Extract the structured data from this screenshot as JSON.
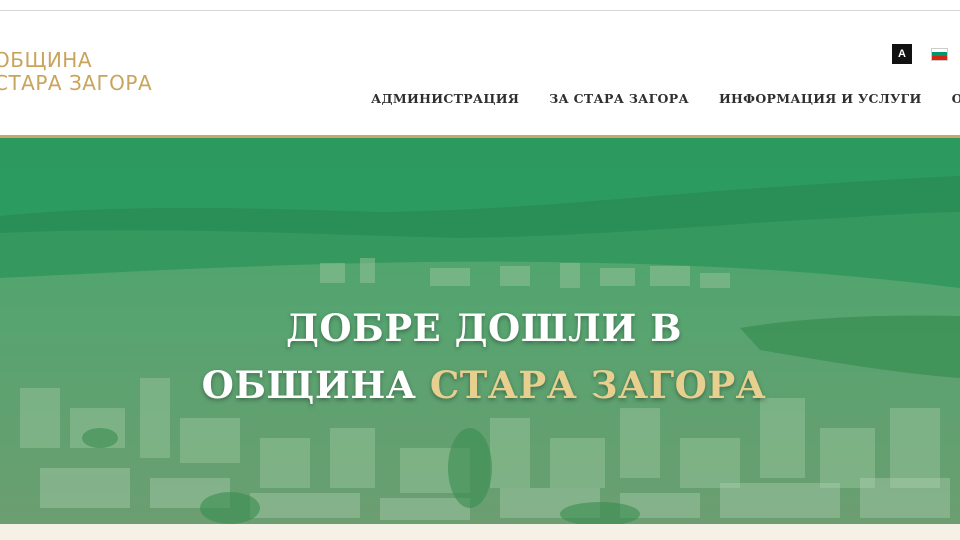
{
  "logo": {
    "line1": "ОБЩИНА",
    "line2": "СТАРА ЗАГОРА"
  },
  "utility": {
    "contrast_label": "A",
    "language_flag": "bulgarian-flag-icon"
  },
  "nav": {
    "items": [
      {
        "label": "АДМИНИСТРАЦИЯ"
      },
      {
        "label": "ЗА СТАРА ЗАГОРА"
      },
      {
        "label": "ИНФОРМАЦИЯ И УСЛУГИ"
      },
      {
        "label": "ОБЩИНА"
      }
    ]
  },
  "hero": {
    "title_line1": "ДОБРЕ ДОШЛИ В",
    "title_line2_white": "ОБЩИНА",
    "title_line2_gold": "СТАРА ЗАГОРА"
  },
  "colors": {
    "brand_gold": "#c9a45c",
    "hero_green": "#2e9a5e",
    "nav_text": "#2f2f2f"
  }
}
